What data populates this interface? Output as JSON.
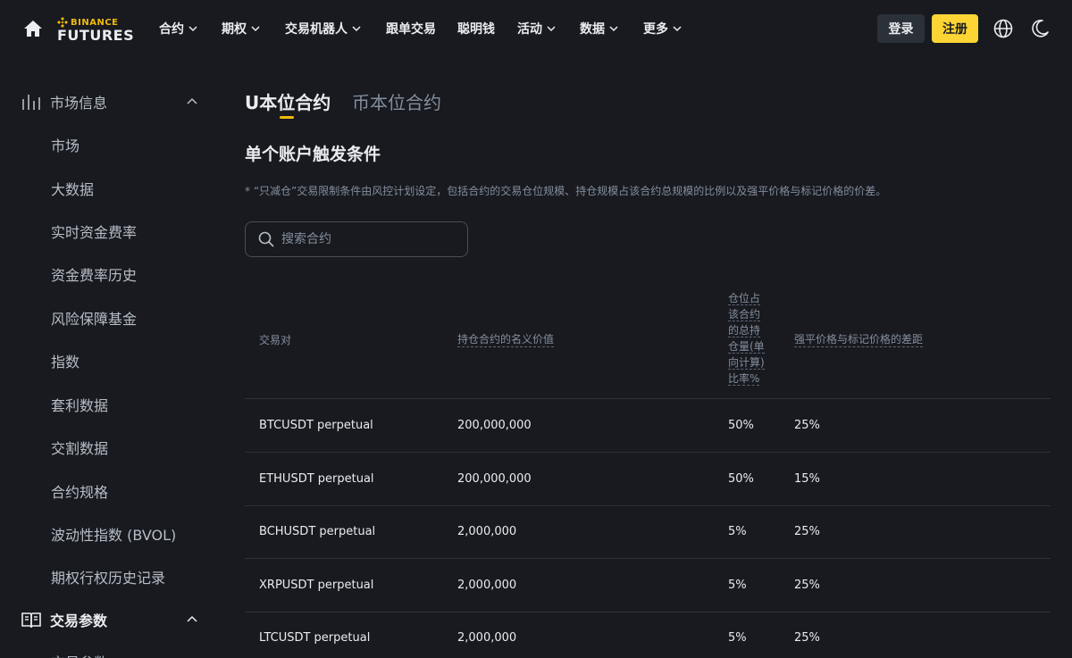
{
  "header": {
    "logo_top": "BINANCE",
    "logo_bottom": "FUTURES",
    "nav": [
      {
        "label": "合约",
        "dropdown": true
      },
      {
        "label": "期权",
        "dropdown": true
      },
      {
        "label": "交易机器人",
        "dropdown": true
      },
      {
        "label": "跟单交易",
        "dropdown": false
      },
      {
        "label": "聪明钱",
        "dropdown": false
      },
      {
        "label": "活动",
        "dropdown": true
      },
      {
        "label": "数据",
        "dropdown": true
      },
      {
        "label": "更多",
        "dropdown": true
      }
    ],
    "login": "登录",
    "register": "注册"
  },
  "sidebar": {
    "group1": "市场信息",
    "items": [
      "市场",
      "大数据",
      "实时资金费率",
      "资金费率历史",
      "风险保障基金",
      "指数",
      "套利数据",
      "交割数据",
      "合约规格",
      "波动性指数 (BVOL)",
      "期权行权历史记录"
    ],
    "group2": "交易参数",
    "partial_item": "交易参数"
  },
  "main": {
    "tabs": [
      "U本位合约",
      "币本位合约"
    ],
    "section_title": "单个账户触发条件",
    "note": "* “只减仓”交易限制条件由风控计划设定，包括合约的交易仓位规模、持仓规模占该合约总规模的比例以及强平价格与标记价格的价差。",
    "search_placeholder": "搜索合约",
    "table": {
      "headers": [
        "交易对",
        "持仓合约的名义价值",
        "仓位占该合约的总持仓量(单向计算)比率%",
        "强平价格与标记价格的差距"
      ],
      "rows": [
        [
          "BTCUSDT perpetual",
          "200,000,000",
          "50%",
          "25%"
        ],
        [
          "ETHUSDT perpetual",
          "200,000,000",
          "50%",
          "15%"
        ],
        [
          "BCHUSDT perpetual",
          "2,000,000",
          "5%",
          "25%"
        ],
        [
          "XRPUSDT perpetual",
          "2,000,000",
          "5%",
          "25%"
        ],
        [
          "LTCUSDT perpetual",
          "2,000,000",
          "5%",
          "25%"
        ]
      ]
    }
  },
  "colors": {
    "accent": "#f0b90b",
    "register_bg": "#fcd535",
    "bg": "#181a20"
  }
}
